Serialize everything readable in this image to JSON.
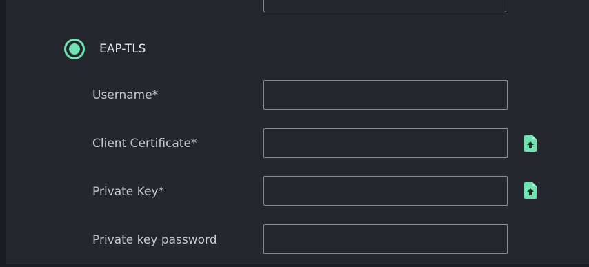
{
  "eap_tls": {
    "radio_label": "EAP-TLS",
    "selected": true
  },
  "fields": {
    "username": {
      "label": "Username*",
      "value": ""
    },
    "client_certificate": {
      "label": "Client Certificate*",
      "value": "",
      "action_icon": "file-upload-icon"
    },
    "private_key": {
      "label": "Private Key*",
      "value": "",
      "action_icon": "file-upload-icon"
    },
    "private_key_password": {
      "label": "Private key password",
      "value": ""
    }
  },
  "colors": {
    "background": "#25272f",
    "accent": "#6fe3b1",
    "input_border": "#8a8d96",
    "label_text": "#c8cad0"
  }
}
